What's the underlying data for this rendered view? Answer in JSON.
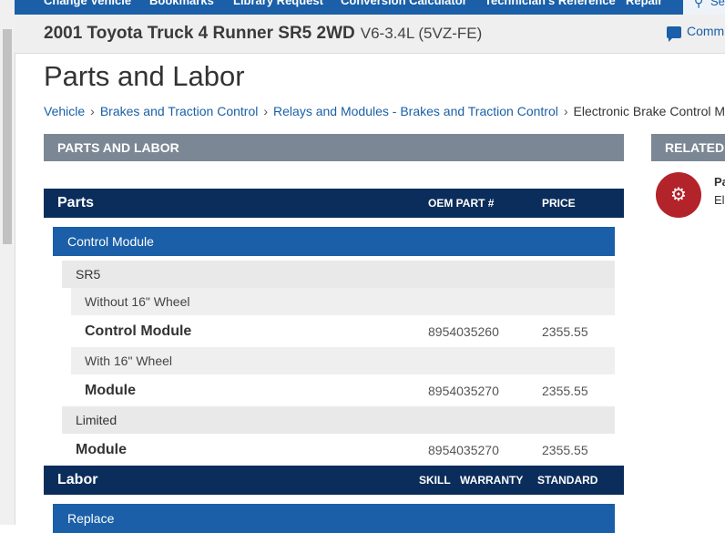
{
  "nav": {
    "items": [
      "Change Vehicle",
      "Bookmarks",
      "Library Request",
      "Conversion Calculator",
      "Technician's Reference",
      "Repair"
    ],
    "search_label": "Search"
  },
  "vehicle": {
    "name": "2001 Toyota Truck 4 Runner SR5 2WD",
    "engine": "V6-3.4L (5VZ-FE)",
    "comment_label": "Comm"
  },
  "page_title": "Parts and Labor",
  "breadcrumb": {
    "links": [
      "Vehicle",
      "Brakes and Traction Control",
      "Relays and Modules - Brakes and Traction Control"
    ],
    "current": "Electronic Brake Control M"
  },
  "section": {
    "title": "PARTS AND LABOR"
  },
  "related": {
    "title": "RELATED I",
    "item_title": "Pa",
    "item_sub": "El",
    "icon": "brake-gauge-icon",
    "icon_color": "#b3232a"
  },
  "parts": {
    "title": "Parts",
    "col_oem": "OEM PART #",
    "col_price": "PRICE",
    "group": "Control Module",
    "sub1": "SR5",
    "cond1": "Without 16\" Wheel",
    "row1": {
      "name": "Control Module",
      "oem": "8954035260",
      "price": "2355.55"
    },
    "cond2": "With 16\" Wheel",
    "row2": {
      "name": "Module",
      "oem": "8954035270",
      "price": "2355.55"
    },
    "sub2": "Limited",
    "row3": {
      "name": "Module",
      "oem": "8954035270",
      "price": "2355.55"
    }
  },
  "labor": {
    "title": "Labor",
    "col_skill": "SKILL",
    "col_warranty": "WARRANTY",
    "col_standard": "STANDARD",
    "group": "Replace"
  },
  "colors": {
    "nav_blue": "#1a5fa8",
    "header_navy": "#0b2d5b",
    "section_gray": "#7b8794"
  }
}
